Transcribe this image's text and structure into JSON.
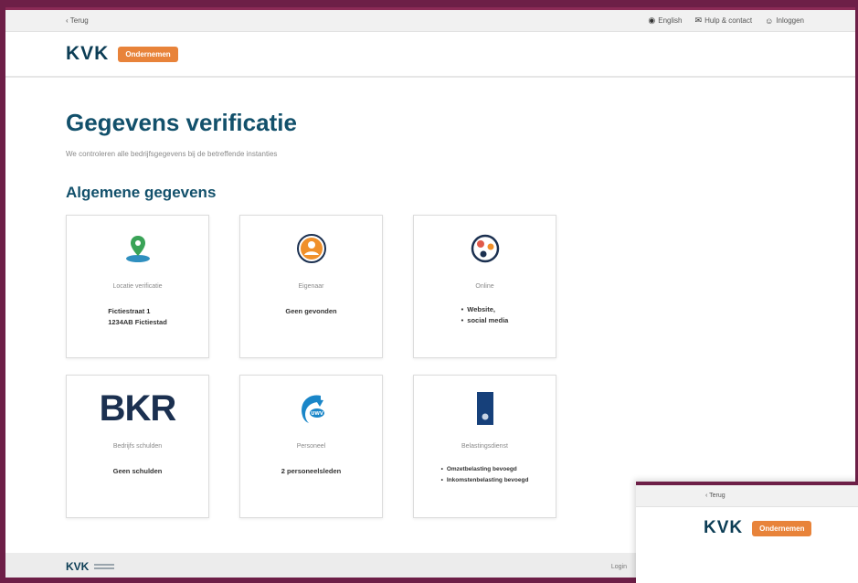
{
  "util_bar": {
    "back": "‹ Terug",
    "items": [
      {
        "icon": "globe-icon",
        "glyph": "◉",
        "label": "English"
      },
      {
        "icon": "chat-icon",
        "glyph": "✉",
        "label": "Hulp & contact"
      },
      {
        "icon": "user-icon",
        "glyph": "☺",
        "label": "Inloggen"
      }
    ]
  },
  "header": {
    "logo": "KVK",
    "badge": "Ondernemen"
  },
  "main": {
    "title": "Gegevens verificatie",
    "subtitle": "We controleren alle bedrijfsgegevens bij de betreffende instanties",
    "section_title": "Algemene gegevens"
  },
  "cards": [
    {
      "label": "Locatie verificatie",
      "value_lines": [
        "Fictiestraat 1",
        "1234AB Fictiestad"
      ]
    },
    {
      "label": "Eigenaar",
      "value": "Geen gevonden"
    },
    {
      "label": "Online",
      "list": [
        "Website,",
        "social media"
      ]
    },
    {
      "label": "Bedrijfs schulden",
      "logo_text": "BKR",
      "value": "Geen schulden"
    },
    {
      "label": "Personeel",
      "logo_text": "UWV",
      "value": "2 personeelsleden"
    },
    {
      "label": "Belastingsdienst",
      "list": [
        "Omzetbelasting bevoegd",
        "Inkomstenbelasting bevoegd"
      ]
    }
  ],
  "footer": {
    "logo": "KVK",
    "link": "Login"
  },
  "overlay": {
    "back": "‹ Terug",
    "logo": "KVK",
    "badge": "Ondernemen"
  },
  "colors": {
    "brand": "#12506b",
    "accent": "#e8833a",
    "frame": "#6d1f47"
  }
}
